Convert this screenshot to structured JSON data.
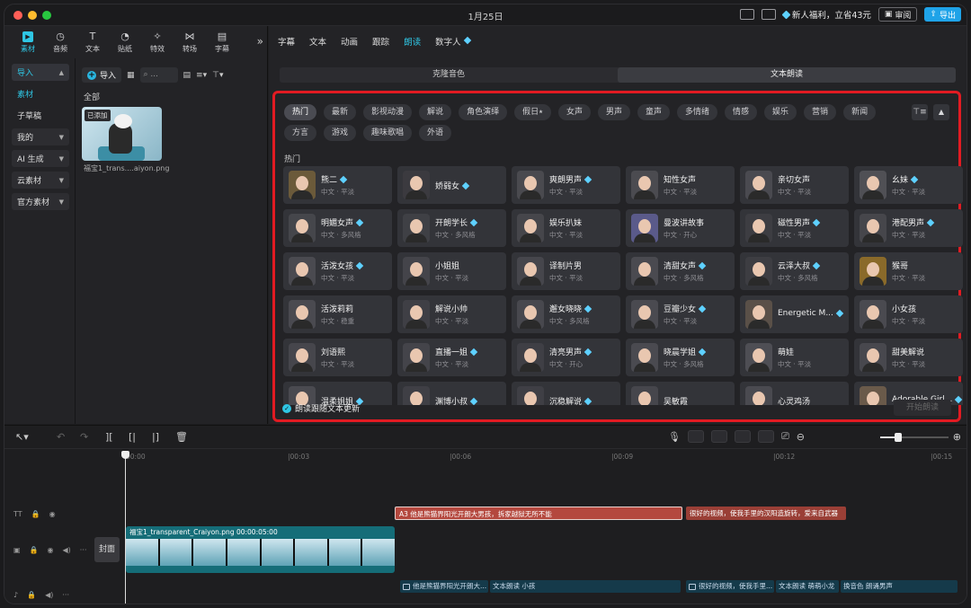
{
  "titlebar": {
    "title": "1月25日",
    "vip_text": "新人福利，立省43元",
    "review_label": "审阅",
    "export_label": "导出"
  },
  "left_panel": {
    "tool_tabs": [
      {
        "label": "素材",
        "icon": "media-icon"
      },
      {
        "label": "音频",
        "icon": "audio-icon"
      },
      {
        "label": "文本",
        "icon": "text-icon"
      },
      {
        "label": "贴纸",
        "icon": "sticker-icon"
      },
      {
        "label": "特效",
        "icon": "effects-icon"
      },
      {
        "label": "转场",
        "icon": "transition-icon"
      },
      {
        "label": "字幕",
        "icon": "caption-icon"
      }
    ],
    "nav": {
      "import": "导入",
      "material": "素材",
      "draft": "子草稿",
      "mine": "我的",
      "ai": "AI 生成",
      "cloud": "云素材",
      "official": "官方素材"
    },
    "import_button": "导入",
    "all_label": "全部",
    "thumb": {
      "badge": "已添加",
      "name": "福宝1_trans....aiyon.png"
    }
  },
  "right_panel": {
    "tabs": [
      "字幕",
      "文本",
      "动画",
      "跟踪",
      "朗读",
      "数字人"
    ],
    "active_tab": "朗读",
    "segments": [
      "克隆音色",
      "文本朗读"
    ],
    "chips": [
      "热门",
      "最新",
      "影视动漫",
      "解说",
      "角色演绎",
      "假日⭑",
      "女声",
      "男声",
      "童声",
      "多情绪",
      "情感",
      "娱乐",
      "营销",
      "新闻",
      "方言",
      "游戏",
      "趣味歌唱",
      "外语"
    ],
    "section_label": "热门",
    "voices": [
      {
        "name": "熊二",
        "sub": "中文 · 平淡",
        "vip": true,
        "bg": "#6b5a3a"
      },
      {
        "name": "娇弱女",
        "sub": "",
        "vip": true,
        "bg": "#3b3a3f"
      },
      {
        "name": "爽朗男声",
        "sub": "中文 · 平淡",
        "vip": true,
        "bg": "#4a4a4f"
      },
      {
        "name": "知性女声",
        "sub": "中文 · 平淡",
        "vip": false,
        "bg": "#4b4b50"
      },
      {
        "name": "亲切女声",
        "sub": "中文 · 平淡",
        "vip": false,
        "bg": "#4a4a50"
      },
      {
        "name": "幺妹",
        "sub": "中文 · 平淡",
        "vip": true,
        "bg": "#505055"
      },
      {
        "name": "明媚女声",
        "sub": "中文 · 多风格",
        "vip": true,
        "bg": "#45464b"
      },
      {
        "name": "开朗学长",
        "sub": "中文 · 多风格",
        "vip": true,
        "bg": "#3f4045"
      },
      {
        "name": "娱乐扒妹",
        "sub": "中文 · 平淡",
        "vip": false,
        "bg": "#46464b"
      },
      {
        "name": "曼波讲故事",
        "sub": "中文 · 开心",
        "vip": false,
        "bg": "#5a5a8a"
      },
      {
        "name": "磁性男声",
        "sub": "中文 · 平淡",
        "vip": true,
        "bg": "#3d3d42"
      },
      {
        "name": "港配男声",
        "sub": "中文 · 平淡",
        "vip": true,
        "bg": "#46464b"
      },
      {
        "name": "活泼女孩",
        "sub": "中文 · 平淡",
        "vip": true,
        "bg": "#4a4a50"
      },
      {
        "name": "小姐姐",
        "sub": "中文 · 平淡",
        "vip": false,
        "bg": "#44444a"
      },
      {
        "name": "译制片男",
        "sub": "中文 · 平淡",
        "vip": false,
        "bg": "#46464c"
      },
      {
        "name": "清甜女声",
        "sub": "中文 · 多风格",
        "vip": true,
        "bg": "#4a4a50"
      },
      {
        "name": "云泽大叔",
        "sub": "中文 · 多风格",
        "vip": true,
        "bg": "#3d3d42"
      },
      {
        "name": "猴哥",
        "sub": "中文 · 平淡",
        "vip": false,
        "bg": "#8a6a2a"
      },
      {
        "name": "活泼莉莉",
        "sub": "中文 · 稳重",
        "vip": false,
        "bg": "#4a4a50"
      },
      {
        "name": "解说小帅",
        "sub": "中文 · 平淡",
        "vip": false,
        "bg": "#3f3f45"
      },
      {
        "name": "邂女晓晓",
        "sub": "中文 · 多风格",
        "vip": true,
        "bg": "#48484e"
      },
      {
        "name": "豆瓣少女",
        "sub": "中文 · 平淡",
        "vip": true,
        "bg": "#4a4a50"
      },
      {
        "name": "Energetic M...",
        "sub": "",
        "vip": true,
        "bg": "#5a5048"
      },
      {
        "name": "小女孩",
        "sub": "中文 · 平淡",
        "vip": false,
        "bg": "#4a4a50"
      },
      {
        "name": "刘语熙",
        "sub": "中文 · 平淡",
        "vip": false,
        "bg": "#46464c"
      },
      {
        "name": "直播一姐",
        "sub": "中文 · 平淡",
        "vip": true,
        "bg": "#44444a"
      },
      {
        "name": "清亮男声",
        "sub": "中文 · 开心",
        "vip": true,
        "bg": "#3f3f45"
      },
      {
        "name": "晓晨学姐",
        "sub": "中文 · 多风格",
        "vip": true,
        "bg": "#4a4a50"
      },
      {
        "name": "萌娃",
        "sub": "中文 · 平淡",
        "vip": false,
        "bg": "#4e4e54"
      },
      {
        "name": "甜美解说",
        "sub": "中文 · 平淡",
        "vip": false,
        "bg": "#48484e"
      },
      {
        "name": "温柔姐姐",
        "sub": "",
        "vip": true,
        "bg": "#4a4a50"
      },
      {
        "name": "渊博小叔",
        "sub": "",
        "vip": true,
        "bg": "#3f3f45"
      },
      {
        "name": "沉稳解说",
        "sub": "",
        "vip": true,
        "bg": "#3f3f45"
      },
      {
        "name": "吴敏霞",
        "sub": "",
        "vip": false,
        "bg": "#46464c"
      },
      {
        "name": "心灵鸡汤",
        "sub": "",
        "vip": false,
        "bg": "#4a4a50"
      },
      {
        "name": "Adorable Girl...",
        "sub": "",
        "vip": true,
        "bg": "#6a5a4a"
      }
    ],
    "follow_label": "朗读跟随文本更新",
    "start_button": "开始朗读"
  },
  "timeline": {
    "ruler": [
      "00:00",
      "|00:03",
      "|00:06",
      "|00:09",
      "|00:12",
      "|00:15"
    ],
    "cover_label": "封面",
    "text_clip_1": "A3  他是熊猫界阳光开朗大男孩，拆家越狱无所不能",
    "text_clip_2": "很好的视频，使我手里的汉阳造旋转，爱来自武器",
    "video_clip_name": "福宝1_transparent_Craiyon.png",
    "video_clip_duration": "00:00:05:00",
    "audio_clips": [
      "他是熊猫界阳光开朗大...",
      "文本朗读 小孩",
      "很好的视频，使我手里...",
      "文本朗读 萌萌小龙",
      "换音色 朗诵男声"
    ]
  },
  "colors": {
    "accent": "#2fc6e4",
    "highlight_border": "#e21b22",
    "export": "#1fa3e8",
    "vip_diamond": "#5ed1ff",
    "text_clip": "#b4483e",
    "video_clip": "#156d78"
  }
}
